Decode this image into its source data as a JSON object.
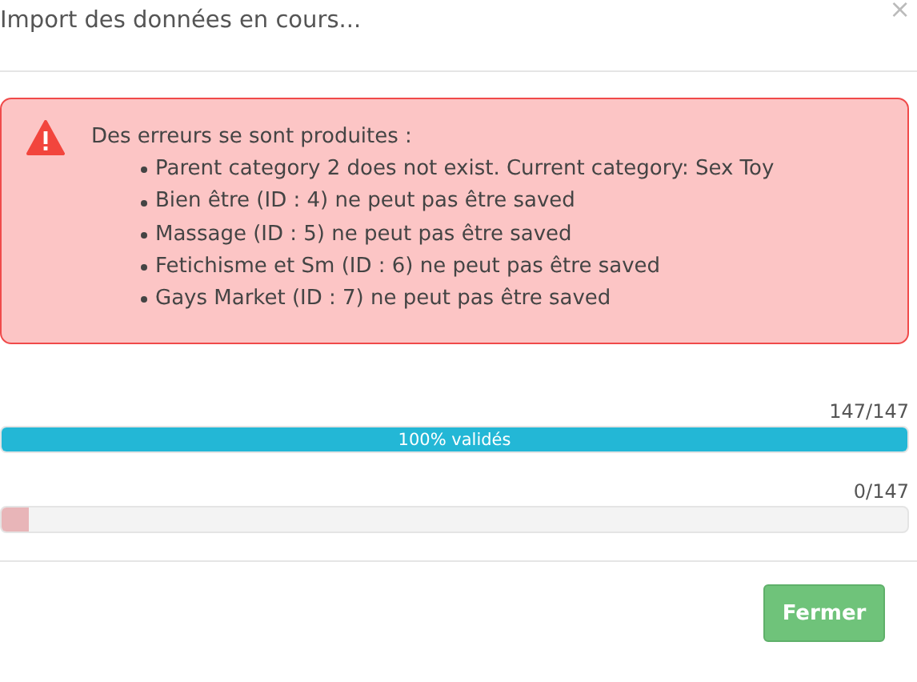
{
  "window": {
    "title": "Import des données en cours...",
    "close": "×"
  },
  "alert": {
    "heading": "Des erreurs se sont produites :",
    "items": [
      "Parent category 2 does not exist. Current category: Sex Toy",
      "Bien être (ID : 4) ne peut pas être saved",
      "Massage (ID : 5) ne peut pas être saved",
      "Fetichisme et Sm (ID : 6) ne peut pas être saved",
      "Gays Market (ID : 7) ne peut pas être saved"
    ]
  },
  "progress": [
    {
      "count": "147/147",
      "level": 1,
      "kind": "success",
      "label": "100% validés"
    },
    {
      "count": "0/147",
      "level": 0.03,
      "kind": "error"
    }
  ],
  "buttons": [
    "Fermer"
  ]
}
